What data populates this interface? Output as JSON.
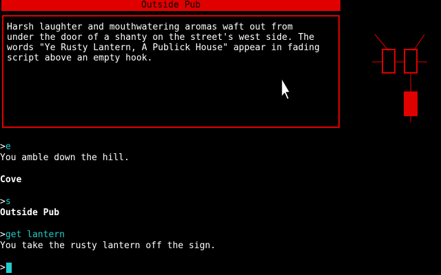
{
  "location": {
    "title": "Outside Pub"
  },
  "description": {
    "text": "Harsh laughter and mouthwatering aromas waft out from\nunder the door of a shanty on the street's west side. The\nwords \"Ye Rusty Lantern, A Publick House\" appear in fading\nscript above an empty hook."
  },
  "colors": {
    "accent": "#e00000",
    "command": "#22cccc",
    "text": "#ffffff",
    "background": "#000000"
  },
  "map": {
    "icon": "compass-map-icon"
  },
  "transcript": {
    "prompt_symbol": ">",
    "entries": [
      {
        "command": "e"
      },
      {
        "output": "You amble down the hill."
      },
      {
        "room": "Cove"
      },
      {
        "command": "s"
      },
      {
        "room": "Outside Pub"
      },
      {
        "command": "get lantern"
      },
      {
        "output": "You take the rusty lantern off the sign."
      }
    ]
  },
  "input": {
    "current_value": ""
  }
}
